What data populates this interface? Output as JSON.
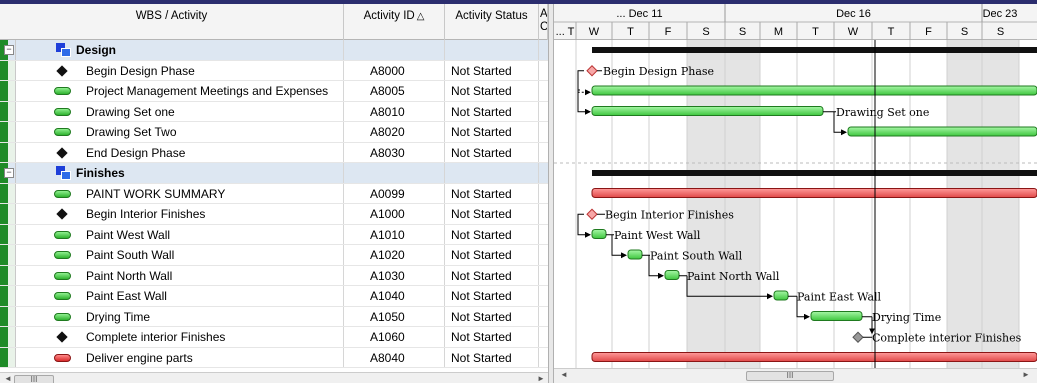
{
  "columns": {
    "wbs": "WBS / Activity",
    "activity_id": "Activity ID",
    "sort_icon": "triangle-up-icon",
    "status": "Activity Status",
    "ac_top": "Act",
    "ac_bottom": "Com"
  },
  "timescale": {
    "weeks": [
      "... Dec 11",
      "Dec 16",
      "Dec 23"
    ],
    "days": [
      "... T",
      "W",
      "T",
      "F",
      "S",
      "S",
      "M",
      "T",
      "W",
      "T",
      "F",
      "S",
      "S"
    ]
  },
  "rows": [
    {
      "type": "wbs",
      "name": "Design",
      "id": "",
      "status": ""
    },
    {
      "type": "milestone",
      "name": "Begin Design Phase",
      "id": "A8000",
      "status": "Not Started"
    },
    {
      "type": "task",
      "name": "Project Management Meetings and Expenses",
      "id": "A8005",
      "status": "Not Started"
    },
    {
      "type": "task",
      "name": "Drawing Set one",
      "id": "A8010",
      "status": "Not Started"
    },
    {
      "type": "task",
      "name": "Drawing Set Two",
      "id": "A8020",
      "status": "Not Started"
    },
    {
      "type": "milestone",
      "name": "End Design Phase",
      "id": "A8030",
      "status": "Not Started"
    },
    {
      "type": "wbs",
      "name": "Finishes",
      "id": "",
      "status": ""
    },
    {
      "type": "task",
      "name": "PAINT WORK SUMMARY",
      "id": "A0099",
      "status": "Not Started"
    },
    {
      "type": "milestone",
      "name": "Begin Interior Finishes",
      "id": "A1000",
      "status": "Not Started"
    },
    {
      "type": "task",
      "name": "Paint West Wall",
      "id": "A1010",
      "status": "Not Started"
    },
    {
      "type": "task",
      "name": "Paint South Wall",
      "id": "A1020",
      "status": "Not Started"
    },
    {
      "type": "task",
      "name": "Paint North Wall",
      "id": "A1030",
      "status": "Not Started"
    },
    {
      "type": "task",
      "name": "Paint East Wall",
      "id": "A1040",
      "status": "Not Started"
    },
    {
      "type": "task",
      "name": "Drying Time",
      "id": "A1050",
      "status": "Not Started"
    },
    {
      "type": "milestone",
      "name": "Complete interior Finishes",
      "id": "A1060",
      "status": "Not Started"
    },
    {
      "type": "critical",
      "name": "Deliver engine parts",
      "id": "A8040",
      "status": "Not Started"
    }
  ],
  "gantt_labels": {
    "begin_design": "Begin Design Phase",
    "drawing_one": "Drawing Set one",
    "begin_interior": "Begin Interior Finishes",
    "west": "Paint West Wall",
    "south": "Paint South Wall",
    "north": "Paint North Wall",
    "east": "Paint East Wall",
    "drying": "Drying Time",
    "complete": "Complete interior Finishes"
  },
  "scroll": {
    "thumb_glyph": "III",
    "left_arrow": "◄",
    "right_arrow": "►"
  },
  "colors": {
    "wbs_band": "#dde7f2",
    "task_bar": "#3ec63e",
    "critical_bar": "#e04848",
    "weekend_shade": "#e4e4e4",
    "gutter": "#1f8b28"
  }
}
